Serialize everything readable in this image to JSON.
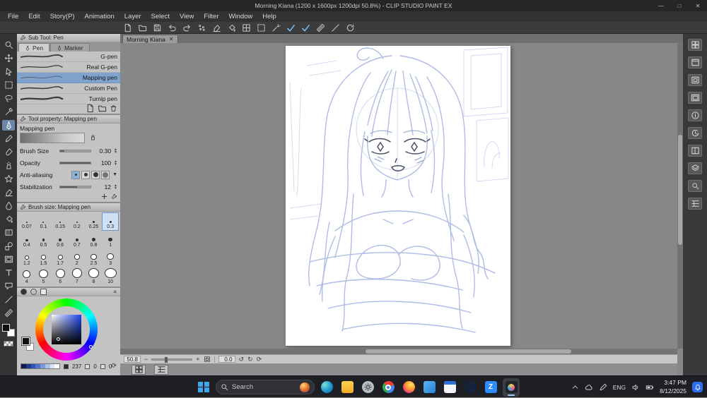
{
  "window": {
    "title": "Morning Kiana (1200 x 1600px 1200dpi 50.8%) - CLIP STUDIO PAINT EX",
    "controls": [
      {
        "name": "minimize",
        "glyph": "—"
      },
      {
        "name": "maximize",
        "glyph": "□"
      },
      {
        "name": "close",
        "glyph": "✕"
      }
    ]
  },
  "menu": {
    "items": [
      "File",
      "Edit",
      "Story(P)",
      "Animation",
      "Layer",
      "Select",
      "View",
      "Filter",
      "Window",
      "Help"
    ]
  },
  "toolbar": {
    "buttons": [
      {
        "name": "new-file",
        "icon": "doc"
      },
      {
        "name": "open-file",
        "icon": "folder"
      },
      {
        "name": "save-file",
        "icon": "save"
      },
      {
        "name": "undo",
        "icon": "undo"
      },
      {
        "name": "redo",
        "icon": "redo"
      },
      {
        "name": "screen-tone",
        "icon": "dots"
      },
      {
        "name": "clear",
        "icon": "eraser"
      },
      {
        "name": "fill",
        "icon": "bucket"
      },
      {
        "name": "grid",
        "icon": "grid"
      },
      {
        "name": "select-rectangle",
        "icon": "select"
      },
      {
        "name": "auto-select",
        "icon": "wand"
      },
      {
        "name": "correct-line",
        "icon": "check",
        "active": true
      },
      {
        "name": "vector-snap",
        "icon": "check",
        "active": true
      },
      {
        "name": "snap-ruler",
        "icon": "ruler"
      },
      {
        "name": "snap-line",
        "icon": "line"
      },
      {
        "name": "rotate-view",
        "icon": "rotate"
      }
    ]
  },
  "tools": {
    "items": [
      {
        "name": "zoom",
        "icon": "zoom"
      },
      {
        "name": "move",
        "icon": "move"
      },
      {
        "name": "operation",
        "icon": "cursor"
      },
      {
        "name": "selection",
        "icon": "select"
      },
      {
        "name": "lasso",
        "icon": "lasso"
      },
      {
        "name": "eyedropper",
        "icon": "dropper"
      },
      {
        "name": "pen",
        "icon": "pen",
        "selected": true
      },
      {
        "name": "pencil",
        "icon": "pencil"
      },
      {
        "name": "brush",
        "icon": "brush"
      },
      {
        "name": "airbrush",
        "icon": "spray"
      },
      {
        "name": "decoration",
        "icon": "star"
      },
      {
        "name": "eraser",
        "icon": "eraser"
      },
      {
        "name": "blend",
        "icon": "drop"
      },
      {
        "name": "fill-tool",
        "icon": "bucket"
      },
      {
        "name": "gradient",
        "icon": "gradient"
      },
      {
        "name": "figure",
        "icon": "shapes"
      },
      {
        "name": "frame-border",
        "icon": "frame"
      },
      {
        "name": "text",
        "icon": "text"
      },
      {
        "name": "balloon",
        "icon": "balloon"
      },
      {
        "name": "line-correction",
        "icon": "line"
      },
      {
        "name": "ruler",
        "icon": "ruler"
      }
    ],
    "foreground": "#101010",
    "background": "#ffffff"
  },
  "subtool": {
    "header": "Sub Tool: Pen",
    "tabs": [
      {
        "label": "Pen",
        "active": true
      },
      {
        "label": "Marker",
        "active": false
      }
    ],
    "items": [
      {
        "label": "G-pen",
        "weight": 2.0
      },
      {
        "label": "Real G-pen",
        "weight": 1.4
      },
      {
        "label": "Mapping pen",
        "weight": 0.7,
        "selected": true
      },
      {
        "label": "Custom Pen",
        "weight": 1.8
      },
      {
        "label": "Turnip pen",
        "weight": 2.6
      }
    ]
  },
  "tool_property": {
    "header": "Tool property: Mapping pen",
    "brush_name": "Mapping pen",
    "rows": {
      "brush_size": {
        "label": "Brush Size",
        "value": "0.30",
        "fill": 0.13
      },
      "opacity": {
        "label": "Opacity",
        "value": "100",
        "fill": 1
      },
      "anti_aliasing": {
        "label": "Anti-aliasing"
      },
      "stabilization": {
        "label": "Stabilization",
        "value": "12",
        "fill": 0.55
      }
    }
  },
  "brush_sizes": {
    "header": "Brush size: Mapping pen",
    "values": [
      "0.07",
      "0.1",
      "0.15",
      "0.2",
      "0.25",
      "0.3",
      "0.4",
      "0.5",
      "0.6",
      "0.7",
      "0.8",
      "1",
      "1.2",
      "1.5",
      "1.7",
      "2",
      "2.5",
      "3",
      "4",
      "5",
      "6",
      "7",
      "8",
      "10"
    ],
    "selected": "0.3"
  },
  "color": {
    "readouts": [
      "237",
      "0",
      "0"
    ],
    "gradient": [
      "#0d1f4e",
      "#1b3c8f",
      "#2d55b8",
      "#4f74cc",
      "#7f9ad9",
      "#adc2e9",
      "#d9e3f5",
      "#ffffff"
    ],
    "foreground": "#101010",
    "background": "#ffffff"
  },
  "canvas": {
    "tab": "Morning Kiana",
    "close": "✕",
    "zoom": "50.8",
    "rotation": "0.0"
  },
  "right_panels": {
    "items": [
      {
        "name": "quick-access",
        "icon": "grid2"
      },
      {
        "name": "material",
        "icon": "panel"
      },
      {
        "name": "navigator",
        "icon": "nav"
      },
      {
        "name": "sub-view",
        "icon": "frame"
      },
      {
        "name": "information",
        "icon": "info"
      },
      {
        "name": "history",
        "icon": "history"
      },
      {
        "name": "layer-property",
        "icon": "panel2"
      },
      {
        "name": "layer",
        "icon": "layers"
      },
      {
        "name": "search-layer",
        "icon": "search"
      },
      {
        "name": "timeline",
        "icon": "tl1"
      }
    ]
  },
  "bottom_bar": {
    "buttons": [
      {
        "name": "timeline-toggle",
        "icon": "grid2"
      },
      {
        "name": "animation-cels",
        "icon": "tl1"
      }
    ]
  },
  "taskbar": {
    "search": {
      "placeholder": "Search"
    },
    "apps": [
      {
        "name": "edge"
      },
      {
        "name": "file-explorer"
      },
      {
        "name": "settings"
      },
      {
        "name": "chrome"
      },
      {
        "name": "firefox"
      },
      {
        "name": "photos"
      },
      {
        "name": "calendar"
      },
      {
        "name": "steam"
      },
      {
        "name": "zoom-app",
        "glyph": "Z"
      },
      {
        "name": "clip-studio",
        "active": true
      }
    ],
    "tray": {
      "lang": "ENG",
      "time": "3:47 PM",
      "date": "8/12/2025"
    }
  }
}
